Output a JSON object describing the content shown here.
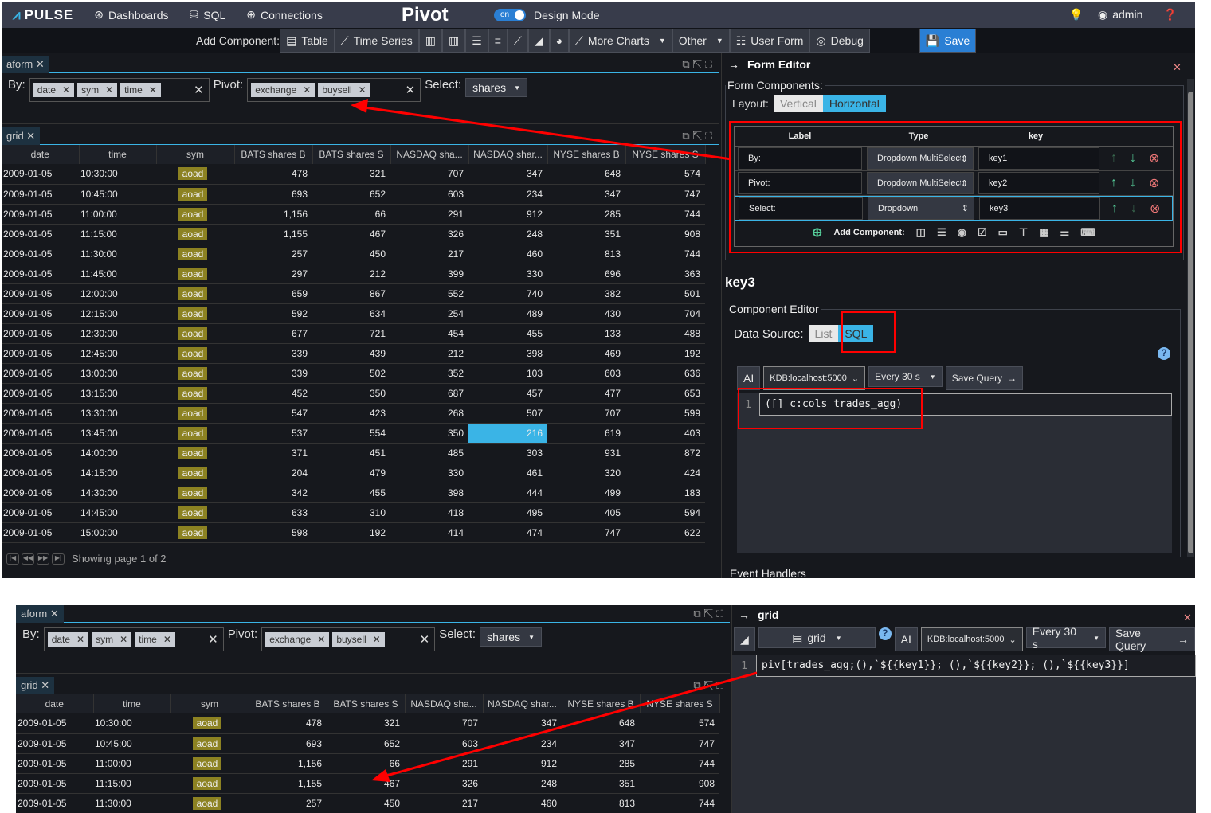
{
  "nav": {
    "logo": "PULSE",
    "items": [
      "Dashboards",
      "SQL",
      "Connections"
    ],
    "title": "Pivot",
    "toggle": "on",
    "design_mode": "Design Mode",
    "user": "admin"
  },
  "toolbar": {
    "add_component": "Add Component:",
    "table": "Table",
    "time_series": "Time Series",
    "more_charts": "More Charts",
    "other": "Other",
    "user_form": "User Form",
    "debug": "Debug",
    "save": "Save"
  },
  "form": {
    "tab": "aform",
    "by_label": "By:",
    "by_chips": [
      "date",
      "sym",
      "time"
    ],
    "pivot_label": "Pivot:",
    "pivot_chips": [
      "exchange",
      "buysell"
    ],
    "select_label": "Select:",
    "select_value": "shares"
  },
  "grid": {
    "tab": "grid",
    "columns": [
      "date",
      "time",
      "sym",
      "BATS shares B",
      "BATS shares S",
      "NASDAQ sha...",
      "NASDAQ shar...",
      "NYSE shares B",
      "NYSE shares S"
    ],
    "rows": [
      [
        "2009-01-05",
        "10:30:00",
        "aoad",
        "478",
        "321",
        "707",
        "347",
        "648",
        "574"
      ],
      [
        "2009-01-05",
        "10:45:00",
        "aoad",
        "693",
        "652",
        "603",
        "234",
        "347",
        "747"
      ],
      [
        "2009-01-05",
        "11:00:00",
        "aoad",
        "1,156",
        "66",
        "291",
        "912",
        "285",
        "744"
      ],
      [
        "2009-01-05",
        "11:15:00",
        "aoad",
        "1,155",
        "467",
        "326",
        "248",
        "351",
        "908"
      ],
      [
        "2009-01-05",
        "11:30:00",
        "aoad",
        "257",
        "450",
        "217",
        "460",
        "813",
        "744"
      ],
      [
        "2009-01-05",
        "11:45:00",
        "aoad",
        "297",
        "212",
        "399",
        "330",
        "696",
        "363"
      ],
      [
        "2009-01-05",
        "12:00:00",
        "aoad",
        "659",
        "867",
        "552",
        "740",
        "382",
        "501"
      ],
      [
        "2009-01-05",
        "12:15:00",
        "aoad",
        "592",
        "634",
        "254",
        "489",
        "430",
        "704"
      ],
      [
        "2009-01-05",
        "12:30:00",
        "aoad",
        "677",
        "721",
        "454",
        "455",
        "133",
        "488"
      ],
      [
        "2009-01-05",
        "12:45:00",
        "aoad",
        "339",
        "439",
        "212",
        "398",
        "469",
        "192"
      ],
      [
        "2009-01-05",
        "13:00:00",
        "aoad",
        "339",
        "502",
        "352",
        "103",
        "603",
        "636"
      ],
      [
        "2009-01-05",
        "13:15:00",
        "aoad",
        "452",
        "350",
        "687",
        "457",
        "477",
        "653"
      ],
      [
        "2009-01-05",
        "13:30:00",
        "aoad",
        "547",
        "423",
        "268",
        "507",
        "707",
        "599"
      ],
      [
        "2009-01-05",
        "13:45:00",
        "aoad",
        "537",
        "554",
        "350",
        "216",
        "619",
        "403"
      ],
      [
        "2009-01-05",
        "14:00:00",
        "aoad",
        "371",
        "451",
        "485",
        "303",
        "931",
        "872"
      ],
      [
        "2009-01-05",
        "14:15:00",
        "aoad",
        "204",
        "479",
        "330",
        "461",
        "320",
        "424"
      ],
      [
        "2009-01-05",
        "14:30:00",
        "aoad",
        "342",
        "455",
        "398",
        "444",
        "499",
        "183"
      ],
      [
        "2009-01-05",
        "14:45:00",
        "aoad",
        "633",
        "310",
        "418",
        "495",
        "405",
        "594"
      ],
      [
        "2009-01-05",
        "15:00:00",
        "aoad",
        "598",
        "192",
        "414",
        "474",
        "747",
        "622"
      ]
    ],
    "pager": "Showing page 1 of 2"
  },
  "editor": {
    "title": "Form Editor",
    "components_legend": "Form Components:",
    "layout_label": "Layout:",
    "layout_options": [
      "Vertical",
      "Horizontal"
    ],
    "layout_selected": "Horizontal",
    "headers": [
      "Label",
      "Type",
      "key"
    ],
    "rows": [
      {
        "label": "By:",
        "type": "Dropdown MultiSelect",
        "key": "key1"
      },
      {
        "label": "Pivot:",
        "type": "Dropdown MultiSelect",
        "key": "key2"
      },
      {
        "label": "Select:",
        "type": "Dropdown",
        "key": "key3"
      }
    ],
    "add_component": "Add Component:",
    "selected_key": "key3",
    "component_editor": "Component Editor",
    "data_source_label": "Data Source:",
    "data_source_options": [
      "List",
      "SQL"
    ],
    "data_source_selected": "SQL",
    "ai": "AI",
    "connection": "KDB:localhost:5000",
    "refresh": "Every 30 s",
    "save_query": "Save Query",
    "line_no": "1",
    "query": "([] c:cols trades_agg)",
    "event_handlers": "Event Handlers"
  },
  "bottom": {
    "panel_title": "grid",
    "chart_type": "grid",
    "query": "piv[trades_agg;(),`${{key1}}; (),`${{key2}}; (),`${{key3}}]"
  },
  "colors": {
    "accent": "#3ab4e6",
    "save": "#2a7fd4",
    "annotation": "#ff0000",
    "sym_badge": "#8c8222"
  }
}
